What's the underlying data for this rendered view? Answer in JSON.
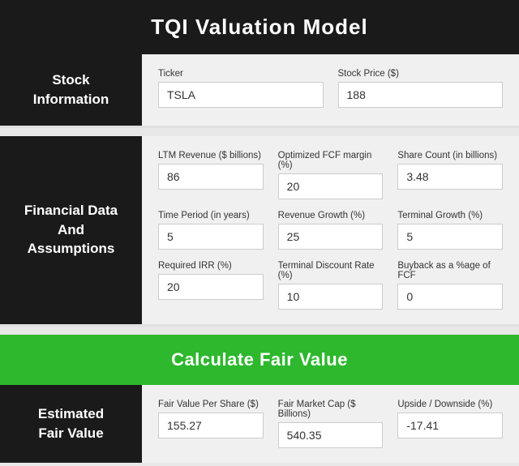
{
  "header": {
    "title": "TQI Valuation Model"
  },
  "stock_section": {
    "label": "Stock\nInformation",
    "fields": [
      {
        "label": "Ticker",
        "value": "TSLA",
        "name": "ticker-input"
      },
      {
        "label": "Stock Price ($)",
        "value": "188",
        "name": "stock-price-input"
      }
    ]
  },
  "financial_section": {
    "label": "Financial Data\nAnd\nAssumptions",
    "rows": [
      [
        {
          "label": "LTM Revenue ($ billions)",
          "value": "86",
          "name": "ltm-revenue-input"
        },
        {
          "label": "Optimized FCF margin (%)",
          "value": "20",
          "name": "fcf-margin-input"
        },
        {
          "label": "Share Count (in billions)",
          "value": "3.48",
          "name": "share-count-input"
        }
      ],
      [
        {
          "label": "Time Period (in years)",
          "value": "5",
          "name": "time-period-input"
        },
        {
          "label": "Revenue Growth (%)",
          "value": "25",
          "name": "revenue-growth-input"
        },
        {
          "label": "Terminal Growth (%)",
          "value": "5",
          "name": "terminal-growth-input"
        }
      ],
      [
        {
          "label": "Required IRR (%)",
          "value": "20",
          "name": "required-irr-input"
        },
        {
          "label": "Terminal Discount Rate (%)",
          "value": "10",
          "name": "terminal-discount-input"
        },
        {
          "label": "Buyback as a %age of FCF",
          "value": "0",
          "name": "buyback-input"
        }
      ]
    ]
  },
  "calculate_button": {
    "label": "Calculate Fair Value"
  },
  "results_section": {
    "label": "Estimated\nFair Value",
    "fields": [
      {
        "label": "Fair Value Per Share ($)",
        "value": "155.27",
        "name": "fair-value-per-share-input"
      },
      {
        "label": "Fair Market Cap ($ Billions)",
        "value": "540.35",
        "name": "fair-market-cap-input"
      },
      {
        "label": "Upside / Downside (%)",
        "value": "-17.41",
        "name": "upside-downside-input"
      }
    ]
  }
}
